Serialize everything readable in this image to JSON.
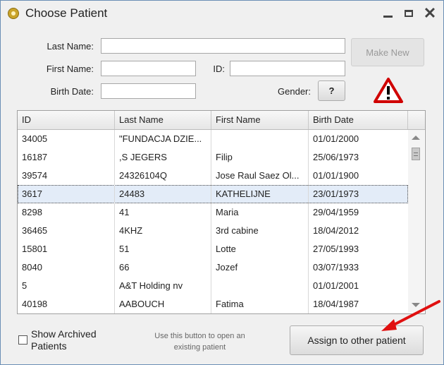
{
  "window": {
    "title": "Choose Patient"
  },
  "form": {
    "last_name_label": "Last Name:",
    "first_name_label": "First Name:",
    "id_label": "ID:",
    "birth_date_label": "Birth Date:",
    "gender_label": "Gender:",
    "last_name_value": "",
    "first_name_value": "",
    "id_value": "",
    "birth_date_value": "",
    "make_new_label": "Make New",
    "gender_button_label": "?"
  },
  "grid": {
    "columns": [
      "ID",
      "Last Name",
      "First Name",
      "Birth Date"
    ],
    "rows": [
      [
        "34005",
        "\"FUNDACJA DZIE...",
        "",
        "01/01/2000"
      ],
      [
        "16187",
        ",S JEGERS",
        "Filip",
        "25/06/1973"
      ],
      [
        "39574",
        "24326104Q",
        "Jose Raul Saez Ol...",
        "01/01/1900"
      ],
      [
        "3617",
        "24483",
        "KATHELIJNE",
        "23/01/1973"
      ],
      [
        "8298",
        "41",
        "Maria",
        "29/04/1959"
      ],
      [
        "36465",
        "4KHZ",
        "3rd cabine",
        "18/04/2012"
      ],
      [
        "15801",
        "51",
        "Lotte",
        "27/05/1993"
      ],
      [
        "8040",
        "66",
        "Jozef",
        "03/07/1933"
      ],
      [
        "5",
        "A&T Holding nv",
        "",
        "01/01/2001"
      ],
      [
        "40198",
        "AABOUCH",
        "Fatima",
        "18/04/1987"
      ]
    ],
    "selected_row": 3
  },
  "footer": {
    "show_archived_label": "Show Archived Patients",
    "show_archived_checked": false,
    "hint_text": "Use this button to open an existing patient",
    "assign_button_label": "Assign to other patient"
  },
  "colors": {
    "warning": "#d00000",
    "arrow": "#e01010",
    "selection": "#e3ecf8"
  },
  "icons": [
    "app-icon",
    "minimize-icon",
    "maximize-icon",
    "close-icon",
    "warning-icon",
    "arrow-icon"
  ]
}
